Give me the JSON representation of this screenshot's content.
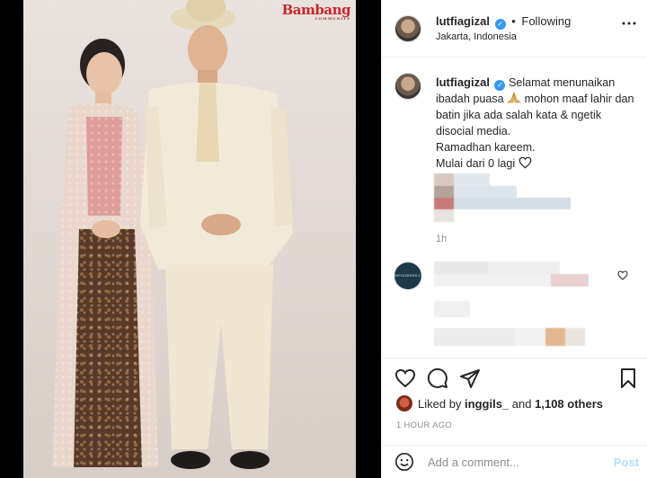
{
  "media": {
    "watermark": "Bambang",
    "watermark_small": "COMMUNITY"
  },
  "post": {
    "username": "lutfiagizal",
    "verified": true,
    "follow_status": "Following",
    "location": "Jakarta, Indonesia",
    "caption_line1": "Selamat menunaikan ibadah puasa",
    "caption_emoji": "praying-hands",
    "caption_rest": "mohon maaf lahir dan batin jika ada salah kata & ngetik disocial media.\nRamadhan kareem.\nMulai dari 0 lagi",
    "caption_time": "1h",
    "comment_avatar_text": "INFOGRESS.CO",
    "likes": {
      "prefix": "Liked by",
      "user": "inggils_",
      "and": "and",
      "others": "1,108 others"
    },
    "posted_ago": "1 HOUR AGO",
    "comment_placeholder": "Add a comment...",
    "post_button": "Post"
  },
  "colors": {
    "verified": "#3897f0",
    "muted": "#8e8e8e",
    "post_disabled": "#b2dffc"
  }
}
